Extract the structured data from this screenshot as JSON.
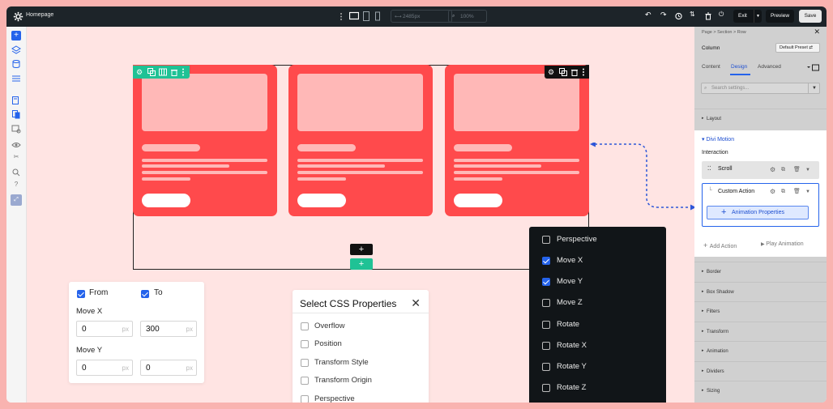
{
  "topbar": {
    "title": "Homepage",
    "width_value": "2485px",
    "zoom_value": "100%",
    "exit_label": "Exit",
    "preview_label": "Preview",
    "save_label": "Save"
  },
  "left_sidebar": {
    "icons": [
      "add-icon",
      "layers-icon",
      "database-icon",
      "sliders-icon",
      "pages-icon",
      "duplicate-pages-icon",
      "page-settings-icon",
      "eye-icon",
      "wireframe-icon",
      "search-icon",
      "help-icon",
      "motion-icon"
    ]
  },
  "canvas": {
    "plus_symbol": "+"
  },
  "from_to_panel": {
    "from_label": "From",
    "to_label": "To",
    "move_x_label": "Move X",
    "move_x_from": "0",
    "move_x_to": "300",
    "move_y_label": "Move Y",
    "move_y_from": "0",
    "move_y_to": "0",
    "unit": "px"
  },
  "css_panel": {
    "title": "Select CSS Properties",
    "close_symbol": "✕",
    "items": [
      "Overflow",
      "Position",
      "Transform Style",
      "Transform Origin",
      "Perspective"
    ]
  },
  "properties_panel": {
    "items": [
      {
        "label": "Perspective",
        "checked": false
      },
      {
        "label": "Move X",
        "checked": true
      },
      {
        "label": "Move Y",
        "checked": true
      },
      {
        "label": "Move Z",
        "checked": false
      },
      {
        "label": "Rotate",
        "checked": false
      },
      {
        "label": "Rotate X",
        "checked": false
      },
      {
        "label": "Rotate Y",
        "checked": false
      },
      {
        "label": "Rotate Z",
        "checked": false
      }
    ]
  },
  "right_sidebar": {
    "breadcrumb": "Page > Section > Row",
    "close_symbol": "✕",
    "column_label": "Column",
    "preset_label": "Default Preset ⇄",
    "tabs": [
      "Content",
      "Design",
      "Advanced"
    ],
    "active_tab": "Design",
    "search_placeholder": "Search settings...",
    "sections_top": [
      "Layout"
    ],
    "motion": {
      "title": "Divi Motion",
      "interaction_label": "Interaction",
      "scroll_label": "Scroll",
      "custom_action_label": "Custom Action",
      "animation_properties_label": "Animation Properties",
      "add_action_label": "Add Action",
      "play_animation_label": "Play Animation"
    },
    "sections_bottom": [
      "Border",
      "Box Shadow",
      "Filters",
      "Transform",
      "Animation",
      "Dividers",
      "Sizing"
    ]
  },
  "colors": {
    "accent_blue": "#2563eb",
    "card_red": "#ff4a4c",
    "row_green": "#1fc295",
    "topbar_dark": "#1d2429"
  }
}
